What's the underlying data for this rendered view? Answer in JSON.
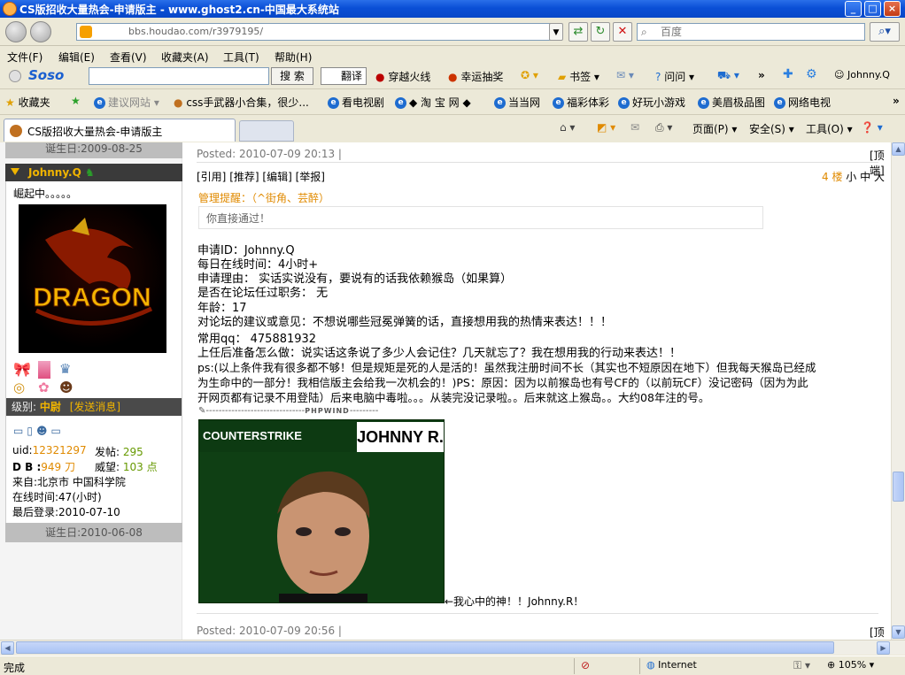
{
  "window": {
    "title": "CS版招收大量热会-申请版主 - www.ghost2.cn-中国最大系统站"
  },
  "address": {
    "url": "bbs.houdao.com/r3979195/",
    "search_placeholder": "百度"
  },
  "menu": {
    "items": [
      "文件(F)",
      "编辑(E)",
      "查看(V)",
      "收藏夹(A)",
      "工具(T)",
      "帮助(H)"
    ]
  },
  "toolbar1": {
    "search_btn": "搜 索",
    "translate": "翻译",
    "game": "穿越火线",
    "lottery": "幸运抽奖",
    "bookmarks": "书签",
    "ask": "问问",
    "user": "Johnny.Q"
  },
  "favbar": {
    "favorites": "收藏夹",
    "suggest": "建议网站",
    "items": [
      "css手武器小合集，很少...",
      "看电视剧",
      "◆ 淘 宝 网 ◆",
      "当当网",
      "福彩体彩",
      "好玩小游戏",
      "美眉极品图",
      "网络电视"
    ]
  },
  "tab": {
    "title": "CS版招收大量热会-申请版主"
  },
  "tabtools": {
    "page": "页面(P)",
    "safety": "安全(S)",
    "tools": "工具(O)"
  },
  "sidebar": {
    "prev_birthday": "诞生日:2009-08-25",
    "username": "Johnny.Q",
    "signature": "崛起中。。。。。",
    "rank_label": "级别:",
    "rank": "中尉",
    "send_msg": "[发送消息]",
    "uid_label": "uid:",
    "uid": "12321297",
    "posts_label": "发帖:",
    "posts": "295",
    "db_label": "D B :",
    "db": "949 刀",
    "prestige_label": "威望:",
    "prestige": "103 点",
    "from": "来自:北京市 中国科学院",
    "online": "在线时间:47(小时)",
    "last_login": "最后登录:2010-07-10",
    "birthday": "诞生日:2010-06-08",
    "avatar_text": "DRAGON"
  },
  "post": {
    "posted_top": "Posted: 2010-07-09 20:13 |",
    "top_link": "[顶端]",
    "actions": [
      "[引用]",
      "[推荐]",
      "[编辑]",
      "[举报]"
    ],
    "floor": "4 楼",
    "font_sizes": [
      "小",
      "中",
      "大"
    ],
    "mod_notice": "管理提醒：（^街角、芸醉）",
    "mod_text": "你直接通过！",
    "lines": [
      "申请ID：Johnny.Q",
      "每日在线时间：4小时+",
      "申请理由：  实话实说没有，要说有的话我依赖猴岛（如果算）",
      "是否在论坛任过职务：  无",
      "年龄：17",
      "对论坛的建议或意见：不想说哪些冠冕弹簧的话，直接想用我的热情来表达！！！",
      "常用qq：  475881932",
      "上任后准备怎么做：说实话这条说了多少人会记住？几天就忘了？我在想用我的行动来表达！！",
      "ps:(以上条件我有很多都不够！但是规矩是死的人是活的！虽然我注册时间不长（其实也不短原因在地下）但我每天猴岛已经成",
      "为生命中的一部分！我相信版主会给我一次机会的！)PS：原因：因为以前猴岛也有号CF的（以前玩CF）没记密码（因为为此",
      "开网页都有记录不用登陆）后来电脑中毒啦。。。从装完没记录啦。。后来就这上猴岛。。大约08年注的号。"
    ],
    "sig_brand": "PHPWIND",
    "banner_left": "COUNTERSTRIKE",
    "banner_right": "JOHNNY R.",
    "caption": "←我心中的神！！Johnny.R！",
    "posted_next": "Posted: 2010-07-09 20:56 |",
    "top_link2": "[顶端]"
  },
  "status": {
    "left": "完成",
    "zone": "Internet",
    "zoom": "105%"
  },
  "colors": {
    "titlebar": "#0a4fd6",
    "accent_orange": "#e08a00",
    "link_green": "#669900",
    "rank_red": "#f0b400"
  }
}
